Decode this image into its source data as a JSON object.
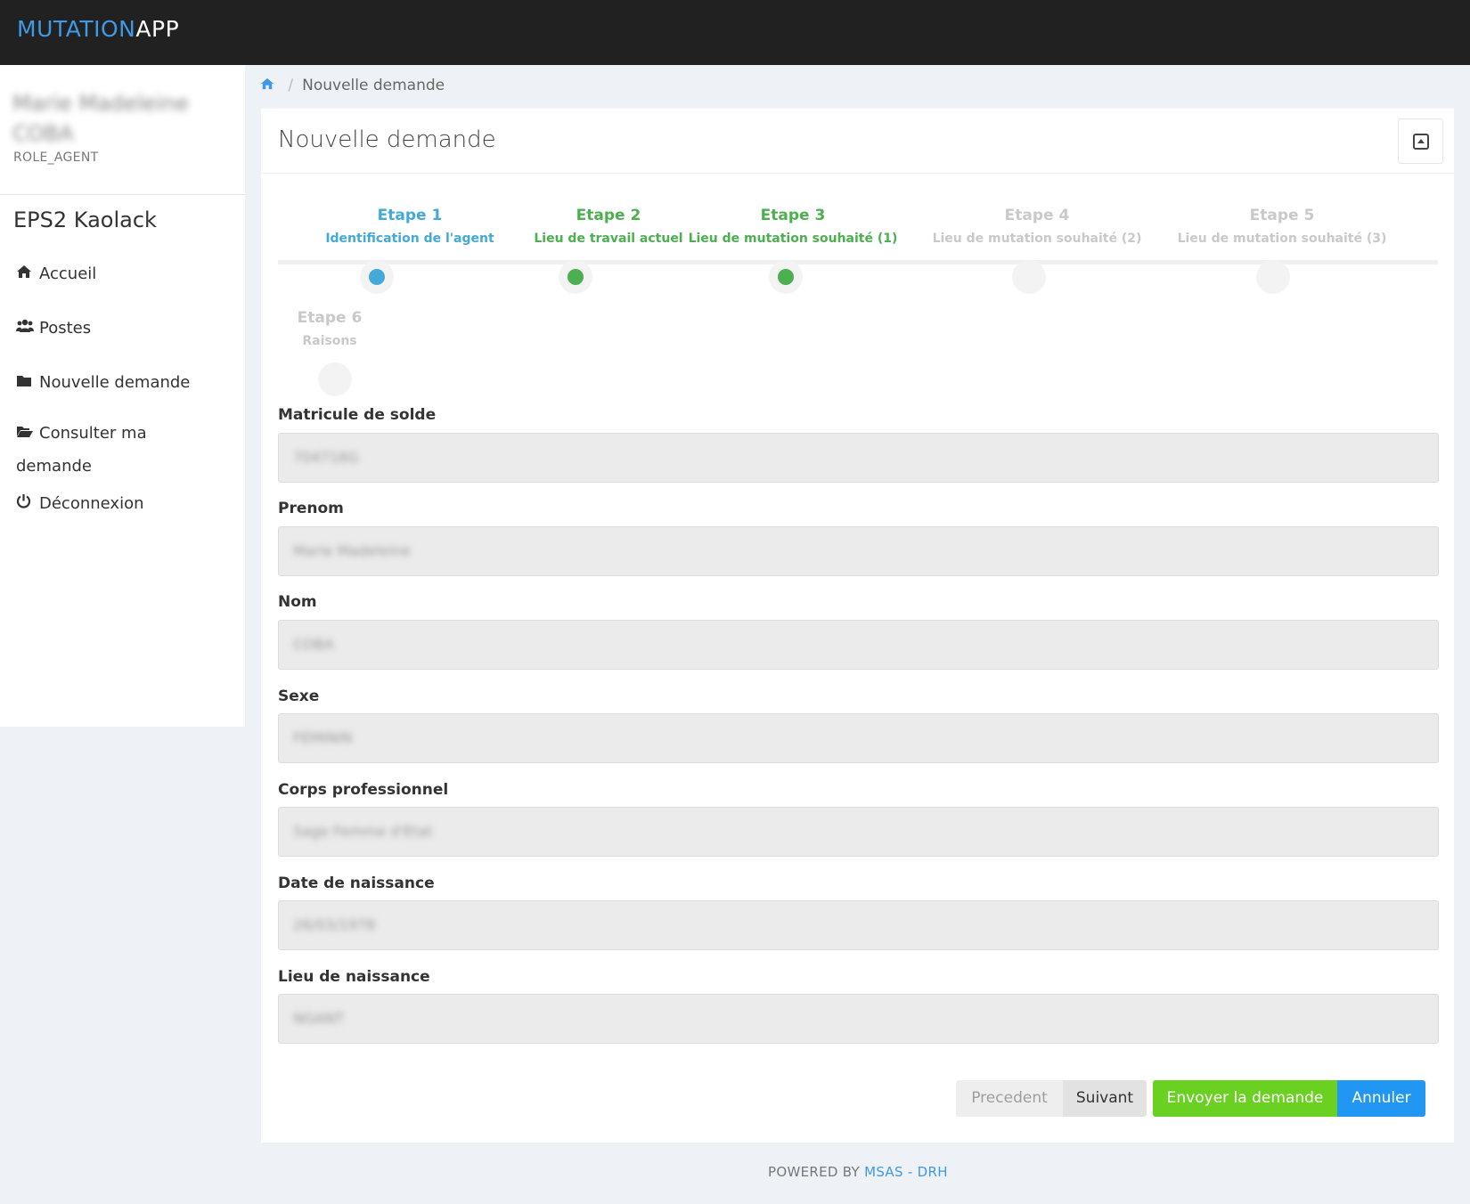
{
  "brand": {
    "part1": "MUTATION",
    "part2": "APP"
  },
  "user": {
    "name": "Marie Madeleine COBA",
    "role": "ROLE_AGENT"
  },
  "site_name": "EPS2 Kaolack",
  "nav": [
    {
      "label": "Accueil",
      "icon": "home-icon"
    },
    {
      "label": "Postes",
      "icon": "users-icon"
    },
    {
      "label": "Nouvelle demande",
      "icon": "folder-icon"
    },
    {
      "label": "Consulter ma demande",
      "icon": "folder-open-icon"
    },
    {
      "label": "Déconnexion",
      "icon": "power-icon"
    }
  ],
  "breadcrumb": {
    "current": "Nouvelle demande"
  },
  "card": {
    "title": "Nouvelle demande"
  },
  "steps": [
    {
      "title": "Etape 1",
      "subtitle": "Identification de l'agent",
      "state": "current",
      "color": "#43a9d8"
    },
    {
      "title": "Etape 2",
      "subtitle": "Lieu de travail actuel",
      "state": "done",
      "color": "#4caf50"
    },
    {
      "title": "Etape 3",
      "subtitle": "Lieu de mutation souhaité (1)",
      "state": "done",
      "color": "#4caf50"
    },
    {
      "title": "Etape 4",
      "subtitle": "Lieu de mutation souhaité (2)",
      "state": "todo",
      "color": "#c9c9c9"
    },
    {
      "title": "Etape 5",
      "subtitle": "Lieu de mutation souhaité (3)",
      "state": "todo",
      "color": "#c9c9c9"
    },
    {
      "title": "Etape 6",
      "subtitle": "Raisons",
      "state": "todo",
      "color": "#c9c9c9"
    }
  ],
  "form": {
    "fields": [
      {
        "label": "Matricule de solde",
        "value": "704716G"
      },
      {
        "label": "Prenom",
        "value": "Marie Madeleine"
      },
      {
        "label": "Nom",
        "value": "COBA"
      },
      {
        "label": "Sexe",
        "value": "FEMININ"
      },
      {
        "label": "Corps professionnel",
        "value": "Sage Femme d'Etat"
      },
      {
        "label": "Date de naissance",
        "value": "26/03/1978"
      },
      {
        "label": "Lieu de naissance",
        "value": "NGANT"
      }
    ]
  },
  "buttons": {
    "prev": "Precedent",
    "next": "Suivant",
    "send": "Envoyer la demande",
    "cancel": "Annuler"
  },
  "footer": {
    "prefix": "POWERED BY ",
    "link": "MSAS - DRH"
  }
}
